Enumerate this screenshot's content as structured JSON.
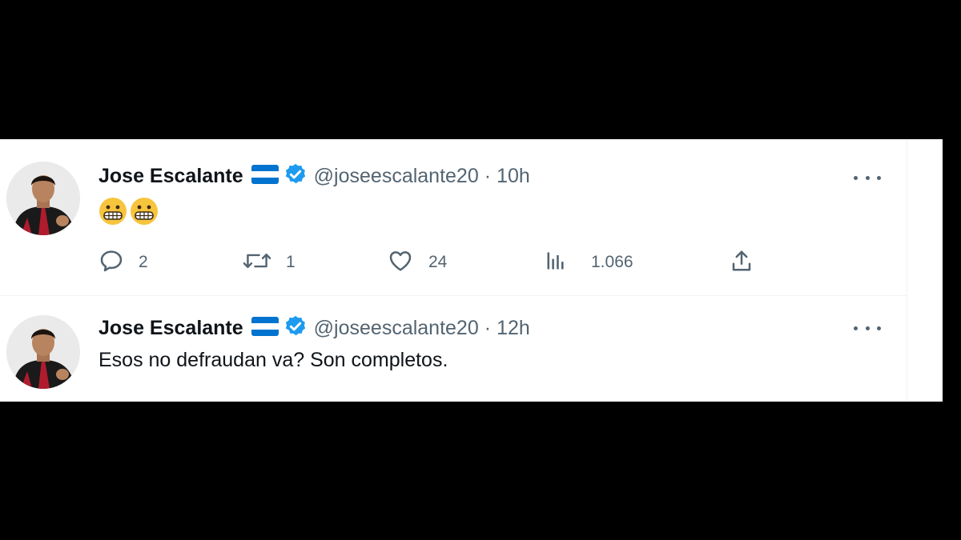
{
  "tweets": [
    {
      "name": "Jose Escalante",
      "handle": "@joseescalante20",
      "separator": "·",
      "time": "10h",
      "text": "😬😬",
      "actions": {
        "replies": "2",
        "retweets": "1",
        "likes": "24",
        "views": "1.066"
      }
    },
    {
      "name": "Jose Escalante",
      "handle": "@joseescalante20",
      "separator": "·",
      "time": "12h",
      "text": "Esos no defraudan va? Son completos."
    }
  ],
  "icons": {
    "flag": "honduras-flag-icon",
    "verified": "verified-badge-icon",
    "more": "more-options-icon",
    "reply": "reply-icon",
    "retweet": "retweet-icon",
    "like": "heart-icon",
    "views": "views-icon",
    "share": "share-icon"
  },
  "colors": {
    "text": "#0f1419",
    "muted": "#536471",
    "verified": "#1d9bf0",
    "flag_blue": "#0073cf",
    "emoji": "#f7c43d"
  }
}
